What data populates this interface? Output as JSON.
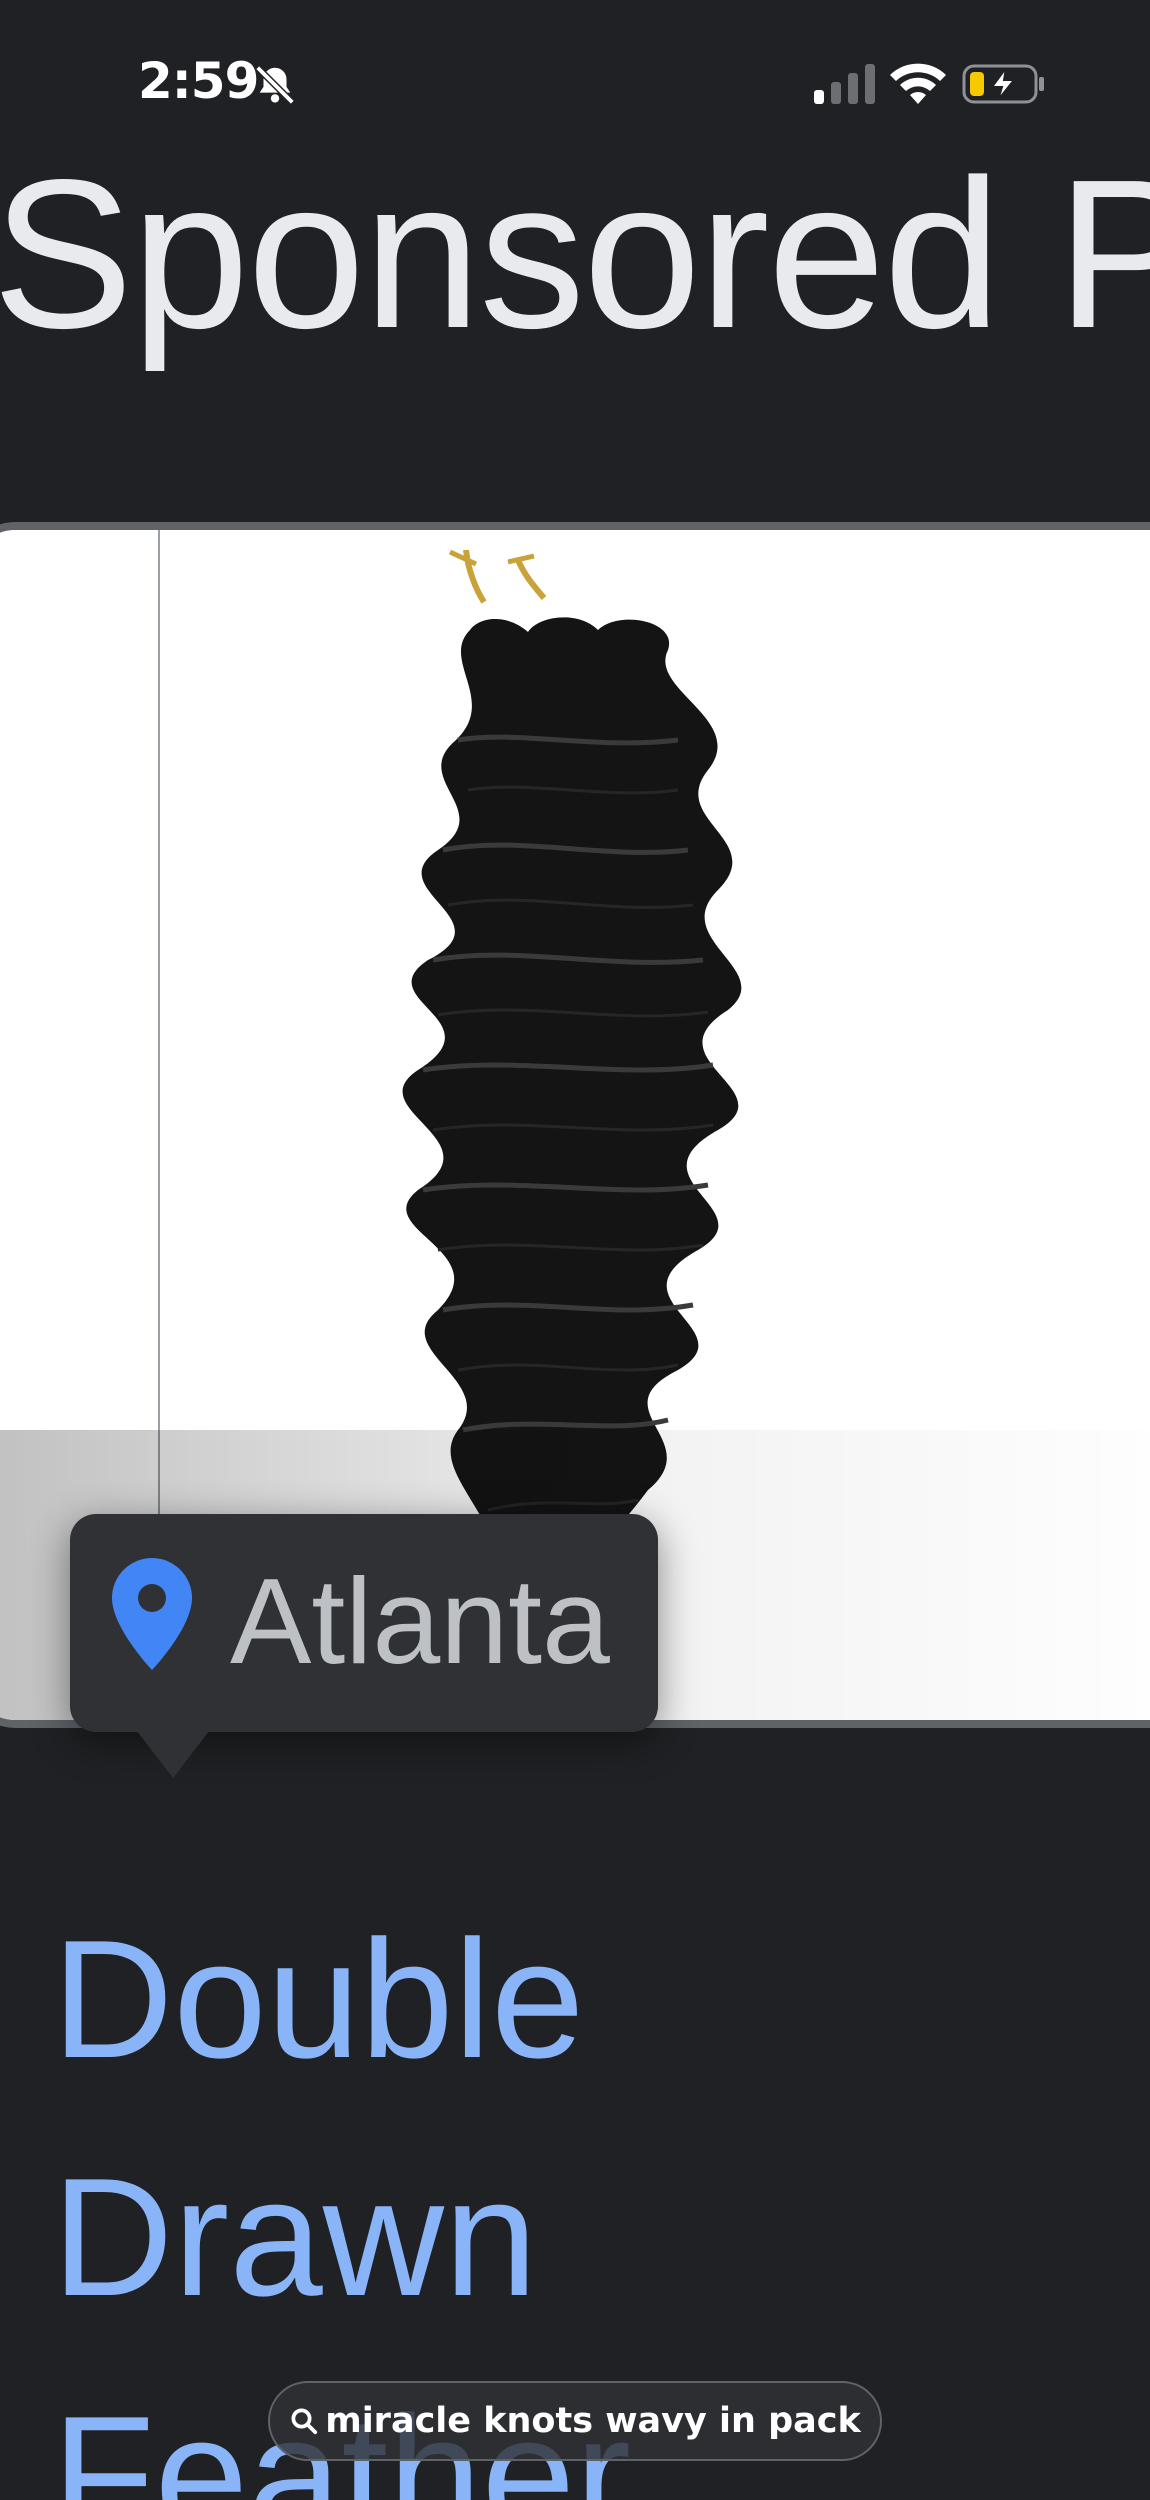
{
  "status_bar": {
    "time": "2:59",
    "icons": [
      "bell-muted-icon",
      "signal-icon",
      "wifi-icon",
      "battery-charging-icon"
    ]
  },
  "heading": "Sponsored Pro",
  "card": {
    "image": "hair-extension-image",
    "location": "Atlanta",
    "location_icon": "map-pin-icon"
  },
  "product": {
    "title_lines": [
      "Double",
      "Drawn",
      "Feather…"
    ]
  },
  "search_pill": {
    "icon": "search-icon",
    "query": "miracle knots wavy in pack"
  },
  "colors": {
    "background": "#202124",
    "heading": "#e8eaed",
    "link": "#8ab4f8",
    "pin": "#4285f4",
    "tooltip_bg": "#303134"
  }
}
